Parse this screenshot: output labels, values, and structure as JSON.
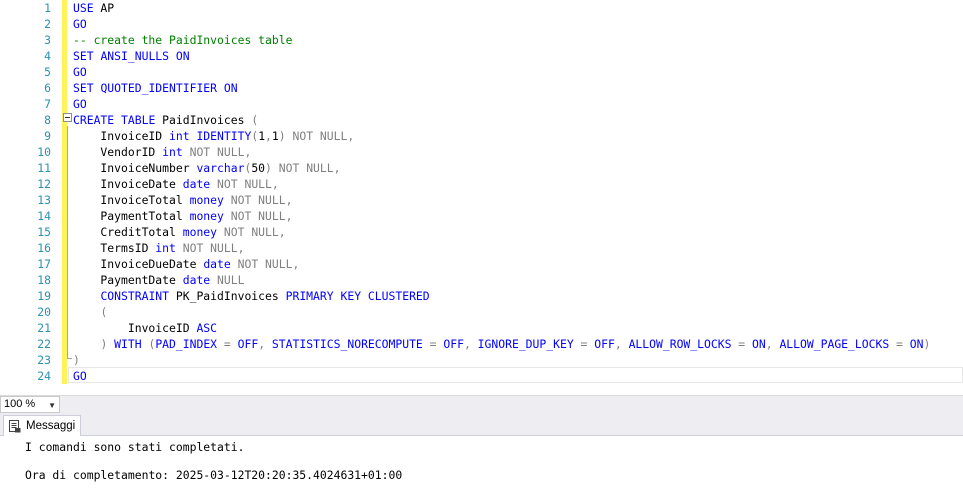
{
  "editor": {
    "lines": [
      {
        "n": "1",
        "parts": [
          {
            "t": "USE",
            "c": "k"
          },
          {
            "t": " AP",
            "c": ""
          }
        ]
      },
      {
        "n": "2",
        "parts": [
          {
            "t": "GO",
            "c": "k"
          }
        ]
      },
      {
        "n": "3",
        "parts": [
          {
            "t": "-- create the PaidInvoices table",
            "c": "c"
          }
        ]
      },
      {
        "n": "4",
        "parts": [
          {
            "t": "SET",
            "c": "k"
          },
          {
            "t": " ",
            "c": ""
          },
          {
            "t": "ANSI_NULLS",
            "c": "k"
          },
          {
            "t": " ",
            "c": ""
          },
          {
            "t": "ON",
            "c": "k"
          }
        ]
      },
      {
        "n": "5",
        "parts": [
          {
            "t": "GO",
            "c": "k"
          }
        ]
      },
      {
        "n": "6",
        "parts": [
          {
            "t": "SET",
            "c": "k"
          },
          {
            "t": " ",
            "c": ""
          },
          {
            "t": "QUOTED_IDENTIFIER",
            "c": "k"
          },
          {
            "t": " ",
            "c": ""
          },
          {
            "t": "ON",
            "c": "k"
          }
        ]
      },
      {
        "n": "7",
        "parts": [
          {
            "t": "GO",
            "c": "k"
          }
        ]
      },
      {
        "n": "8",
        "parts": [
          {
            "t": "CREATE",
            "c": "k"
          },
          {
            "t": " ",
            "c": ""
          },
          {
            "t": "TABLE",
            "c": "k"
          },
          {
            "t": " PaidInvoices ",
            "c": ""
          },
          {
            "t": "(",
            "c": "g"
          }
        ]
      },
      {
        "n": "9",
        "parts": [
          {
            "t": "    InvoiceID ",
            "c": ""
          },
          {
            "t": "int",
            "c": "k"
          },
          {
            "t": " ",
            "c": ""
          },
          {
            "t": "IDENTITY",
            "c": "k"
          },
          {
            "t": "(",
            "c": "g"
          },
          {
            "t": "1",
            "c": ""
          },
          {
            "t": ",",
            "c": "g"
          },
          {
            "t": "1",
            "c": ""
          },
          {
            "t": ")",
            "c": "g"
          },
          {
            "t": " ",
            "c": ""
          },
          {
            "t": "NOT NULL",
            "c": "g"
          },
          {
            "t": ",",
            "c": "g"
          }
        ]
      },
      {
        "n": "10",
        "parts": [
          {
            "t": "    VendorID ",
            "c": ""
          },
          {
            "t": "int",
            "c": "k"
          },
          {
            "t": " ",
            "c": ""
          },
          {
            "t": "NOT NULL",
            "c": "g"
          },
          {
            "t": ",",
            "c": "g"
          }
        ]
      },
      {
        "n": "11",
        "parts": [
          {
            "t": "    InvoiceNumber ",
            "c": ""
          },
          {
            "t": "varchar",
            "c": "k"
          },
          {
            "t": "(",
            "c": "g"
          },
          {
            "t": "50",
            "c": ""
          },
          {
            "t": ")",
            "c": "g"
          },
          {
            "t": " ",
            "c": ""
          },
          {
            "t": "NOT NULL",
            "c": "g"
          },
          {
            "t": ",",
            "c": "g"
          }
        ]
      },
      {
        "n": "12",
        "parts": [
          {
            "t": "    InvoiceDate ",
            "c": ""
          },
          {
            "t": "date",
            "c": "k"
          },
          {
            "t": " ",
            "c": ""
          },
          {
            "t": "NOT NULL",
            "c": "g"
          },
          {
            "t": ",",
            "c": "g"
          }
        ]
      },
      {
        "n": "13",
        "parts": [
          {
            "t": "    InvoiceTotal ",
            "c": ""
          },
          {
            "t": "money",
            "c": "k"
          },
          {
            "t": " ",
            "c": ""
          },
          {
            "t": "NOT NULL",
            "c": "g"
          },
          {
            "t": ",",
            "c": "g"
          }
        ]
      },
      {
        "n": "14",
        "parts": [
          {
            "t": "    PaymentTotal ",
            "c": ""
          },
          {
            "t": "money",
            "c": "k"
          },
          {
            "t": " ",
            "c": ""
          },
          {
            "t": "NOT NULL",
            "c": "g"
          },
          {
            "t": ",",
            "c": "g"
          }
        ]
      },
      {
        "n": "15",
        "parts": [
          {
            "t": "    CreditTotal ",
            "c": ""
          },
          {
            "t": "money",
            "c": "k"
          },
          {
            "t": " ",
            "c": ""
          },
          {
            "t": "NOT NULL",
            "c": "g"
          },
          {
            "t": ",",
            "c": "g"
          }
        ]
      },
      {
        "n": "16",
        "parts": [
          {
            "t": "    TermsID ",
            "c": ""
          },
          {
            "t": "int",
            "c": "k"
          },
          {
            "t": " ",
            "c": ""
          },
          {
            "t": "NOT NULL",
            "c": "g"
          },
          {
            "t": ",",
            "c": "g"
          }
        ]
      },
      {
        "n": "17",
        "parts": [
          {
            "t": "    InvoiceDueDate ",
            "c": ""
          },
          {
            "t": "date",
            "c": "k"
          },
          {
            "t": " ",
            "c": ""
          },
          {
            "t": "NOT NULL",
            "c": "g"
          },
          {
            "t": ",",
            "c": "g"
          }
        ]
      },
      {
        "n": "18",
        "parts": [
          {
            "t": "    PaymentDate ",
            "c": ""
          },
          {
            "t": "date",
            "c": "k"
          },
          {
            "t": " ",
            "c": ""
          },
          {
            "t": "NULL",
            "c": "g"
          }
        ]
      },
      {
        "n": "19",
        "parts": [
          {
            "t": "    ",
            "c": ""
          },
          {
            "t": "CONSTRAINT",
            "c": "k"
          },
          {
            "t": " PK_PaidInvoices ",
            "c": ""
          },
          {
            "t": "PRIMARY",
            "c": "k"
          },
          {
            "t": " ",
            "c": ""
          },
          {
            "t": "KEY",
            "c": "k"
          },
          {
            "t": " ",
            "c": ""
          },
          {
            "t": "CLUSTERED",
            "c": "k"
          }
        ]
      },
      {
        "n": "20",
        "parts": [
          {
            "t": "    ",
            "c": ""
          },
          {
            "t": "(",
            "c": "g"
          }
        ]
      },
      {
        "n": "21",
        "parts": [
          {
            "t": "        InvoiceID ",
            "c": ""
          },
          {
            "t": "ASC",
            "c": "k"
          }
        ]
      },
      {
        "n": "22",
        "parts": [
          {
            "t": "    ",
            "c": ""
          },
          {
            "t": ")",
            "c": "g"
          },
          {
            "t": " ",
            "c": ""
          },
          {
            "t": "WITH",
            "c": "k"
          },
          {
            "t": " ",
            "c": ""
          },
          {
            "t": "(",
            "c": "g"
          },
          {
            "t": "PAD_INDEX",
            "c": "k"
          },
          {
            "t": " ",
            "c": ""
          },
          {
            "t": "=",
            "c": "g"
          },
          {
            "t": " ",
            "c": ""
          },
          {
            "t": "OFF",
            "c": "k"
          },
          {
            "t": ",",
            "c": "g"
          },
          {
            "t": " ",
            "c": ""
          },
          {
            "t": "STATISTICS_NORECOMPUTE",
            "c": "k"
          },
          {
            "t": " ",
            "c": ""
          },
          {
            "t": "=",
            "c": "g"
          },
          {
            "t": " ",
            "c": ""
          },
          {
            "t": "OFF",
            "c": "k"
          },
          {
            "t": ",",
            "c": "g"
          },
          {
            "t": " ",
            "c": ""
          },
          {
            "t": "IGNORE_DUP_KEY",
            "c": "k"
          },
          {
            "t": " ",
            "c": ""
          },
          {
            "t": "=",
            "c": "g"
          },
          {
            "t": " ",
            "c": ""
          },
          {
            "t": "OFF",
            "c": "k"
          },
          {
            "t": ",",
            "c": "g"
          },
          {
            "t": " ",
            "c": ""
          },
          {
            "t": "ALLOW_ROW_LOCKS",
            "c": "k"
          },
          {
            "t": " ",
            "c": ""
          },
          {
            "t": "=",
            "c": "g"
          },
          {
            "t": " ",
            "c": ""
          },
          {
            "t": "ON",
            "c": "k"
          },
          {
            "t": ",",
            "c": "g"
          },
          {
            "t": " ",
            "c": ""
          },
          {
            "t": "ALLOW_PAGE_LOCKS",
            "c": "k"
          },
          {
            "t": " ",
            "c": ""
          },
          {
            "t": "=",
            "c": "g"
          },
          {
            "t": " ",
            "c": ""
          },
          {
            "t": "ON",
            "c": "k"
          },
          {
            "t": ")",
            "c": "g"
          }
        ]
      },
      {
        "n": "23",
        "parts": [
          {
            "t": ")",
            "c": "g"
          }
        ]
      },
      {
        "n": "24",
        "parts": [
          {
            "t": "GO",
            "c": "k"
          }
        ]
      }
    ]
  },
  "statusbar": {
    "zoom": "100 %"
  },
  "results": {
    "tab_label": "Messaggi",
    "tab_icon": "messages-icon",
    "messages": [
      "I comandi sono stati completati.",
      "",
      "Ora di completamento: 2025-03-12T20:20:35.4024631+01:00"
    ]
  }
}
